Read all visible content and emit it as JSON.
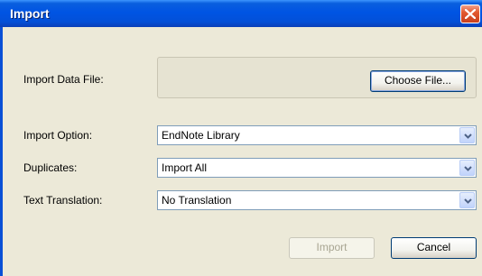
{
  "window": {
    "title": "Import"
  },
  "form": {
    "import_data_file_label": "Import Data File:",
    "choose_file_label": "Choose File...",
    "import_option_label": "Import Option:",
    "import_option_value": "EndNote Library",
    "duplicates_label": "Duplicates:",
    "duplicates_value": "Import All",
    "text_translation_label": "Text Translation:",
    "text_translation_value": "No Translation"
  },
  "buttons": {
    "import_label": "Import",
    "cancel_label": "Cancel"
  },
  "icons": {
    "close": "close-icon",
    "dropdown": "chevron-down-icon"
  },
  "colors": {
    "titlebar": "#0054e3",
    "dialog_bg": "#ece9d8",
    "close_button": "#e2592f"
  }
}
